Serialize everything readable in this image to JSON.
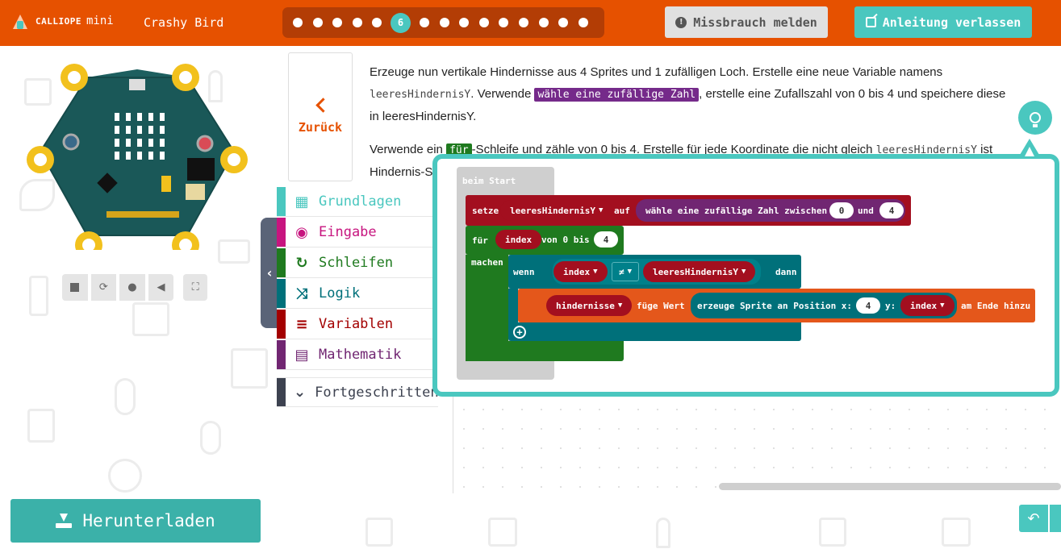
{
  "header": {
    "brand_word": "CALLIOPE",
    "brand_mini": "mini",
    "project_name": "Crashy Bird",
    "current_step": "6",
    "report_label": "Missbrauch melden",
    "exit_label": "Anleitung verlassen"
  },
  "tutorial": {
    "back_label": "Zurück",
    "p1_a": "Erzeuge nun vertikale Hindernisse aus 4 Sprites und 1 zufälligen Loch. Erstelle eine neue Variable namens",
    "p1_code": "leeresHindernisY",
    "p1_b": ". Verwende ",
    "p1_block": "wähle eine zufällige Zahl",
    "p1_c": ", erstelle eine Zufallszahl von 0 bis 4 und speichere diese in leeresHindernisY.",
    "p2_a": "Verwende ein ",
    "p2_block": "für",
    "p2_b": "-Schleife und zähle von 0 bis 4. Erstelle für jede Koordinate die nicht gleich ",
    "p2_code": "leeresHindernisY",
    "p2_c": " ist",
    "p2_d": "Hindernis-S"
  },
  "toolbox": {
    "categories": [
      {
        "label": "Grundlagen",
        "color": "#1e90ff"
      },
      {
        "label": "Eingabe",
        "color": "#c7157f"
      },
      {
        "label": "Schleifen",
        "color": "#1f7a1f"
      },
      {
        "label": "Logik",
        "color": "#00707a"
      },
      {
        "label": "Variablen",
        "color": "#a30000"
      },
      {
        "label": "Mathematik",
        "color": "#712672"
      },
      {
        "label": "Fortgeschritten",
        "color": "#3d4250"
      }
    ]
  },
  "hint_blocks": {
    "on_start": "beim Start",
    "set": "setze",
    "var_empty": "leeresHindernisY",
    "to": "auf",
    "random": "wähle eine zufällige Zahl zwischen",
    "rand_min": "0",
    "and": "und",
    "rand_max": "4",
    "for": "für",
    "index": "index",
    "from0to": "von 0 bis",
    "for_max": "4",
    "do": "machen",
    "if": "wenn",
    "neq": "≠",
    "then": "dann",
    "list_var": "hindernisse",
    "add_value": "füge Wert",
    "create_sprite": "erzeuge Sprite an Position x:",
    "x_val": "4",
    "y_label": "y:",
    "append_end": "am Ende hinzu"
  },
  "footer": {
    "download_label": "Herunterladen"
  },
  "colors": {
    "topbar": "#e65100",
    "accent": "#4ac7bf"
  }
}
